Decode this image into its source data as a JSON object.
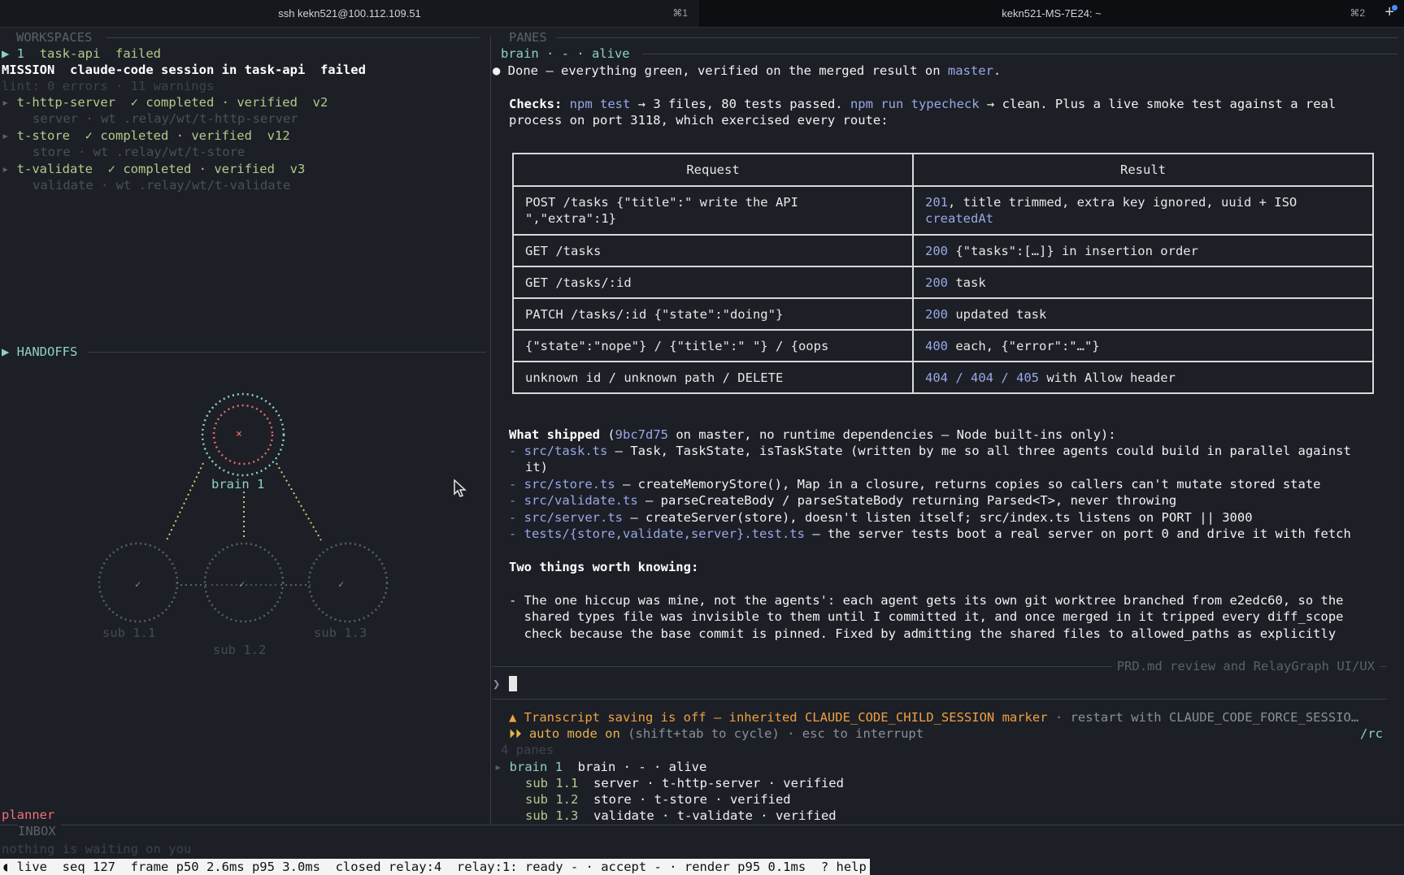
{
  "tabs": [
    {
      "title": "ssh kekn521@100.112.109.51",
      "shortcut": "⌘1"
    },
    {
      "title": "kekn521-MS-7E24: ~",
      "shortcut": "⌘2"
    }
  ],
  "new_tab_label": "+",
  "left": {
    "workspaces_header": "WORKSPACES",
    "workspace": {
      "index": "1",
      "name": "task-api",
      "status": "failed"
    },
    "mission": {
      "label": "MISSION",
      "text": "claude-code session in task-api",
      "status": "failed"
    },
    "lint": "lint: 0 errors · 11 warnings",
    "tasks": [
      {
        "name": "t-http-server",
        "status": "✓ completed · verified",
        "version": "v2",
        "detail": "server · wt .relay/wt/t-http-server"
      },
      {
        "name": "t-store",
        "status": "✓ completed · verified",
        "version": "v12",
        "detail": "store · wt .relay/wt/t-store"
      },
      {
        "name": "t-validate",
        "status": "✓ completed · verified",
        "version": "v3",
        "detail": "validate · wt .relay/wt/t-validate"
      }
    ],
    "handoffs_header": "HANDOFFS",
    "graph": {
      "brain_label": "brain 1",
      "brain_mark": "×",
      "subs": [
        {
          "label": "sub 1.1",
          "mark": "✓"
        },
        {
          "label": "sub 1.2",
          "mark": "✓"
        },
        {
          "label": "sub 1.3",
          "mark": "✓"
        }
      ]
    },
    "planner": "planner",
    "inbox_header": "INBOX",
    "inbox_text": "nothing is waiting on you"
  },
  "right": {
    "panes_header": "PANES",
    "pane_title": "brain · - · alive",
    "done_line": {
      "text": "Done — everything green, verified on the merged result on ",
      "branch": "master",
      "end": "."
    },
    "checks": {
      "label": "Checks:",
      "cmd1": "npm test",
      "res1": " → 3 files, 80 tests passed. ",
      "cmd2": "npm run typecheck",
      "res2": " → clean. Plus a live smoke test against a real",
      "line2": "process on port 3118, which exercised every route:"
    },
    "table": {
      "headers": [
        "Request",
        "Result"
      ],
      "rows": [
        {
          "req": [
            "POST /tasks {\"title\":\"  write the API",
            "\",\"extra\":1}"
          ],
          "res_num": "201",
          "res": [
            ", title trimmed, extra key ignored, uuid + ISO",
            "createdAt"
          ]
        },
        {
          "req": [
            "GET /tasks"
          ],
          "res_num": "200",
          "res": [
            " {\"tasks\":[…]} in insertion order"
          ]
        },
        {
          "req": [
            "GET /tasks/:id"
          ],
          "res_num": "200",
          "res": [
            " task"
          ]
        },
        {
          "req": [
            "PATCH /tasks/:id {\"state\":\"doing\"}"
          ],
          "res_num": "200",
          "res": [
            " updated task"
          ]
        },
        {
          "req": [
            "{\"state\":\"nope\"} / {\"title\":\"   \"} / {oops"
          ],
          "res_num": "400",
          "res": [
            " each, {\"error\":\"…\"}"
          ]
        },
        {
          "req": [
            "unknown id / unknown path / DELETE"
          ],
          "res_num": "404 / 404 / 405",
          "res": [
            " with Allow header"
          ]
        }
      ]
    },
    "shipped": {
      "label": "What shipped",
      "hash": "9bc7d75",
      "rest": " on master, no runtime dependencies — Node built-ins only):",
      "items": [
        {
          "file": "src/task.ts",
          "text": " — Task, TaskState, isTaskState (written by me so all three agents could build in parallel against",
          "cont": "it)"
        },
        {
          "file": "src/store.ts",
          "text": " — createMemoryStore(), Map in a closure, returns copies so callers can't mutate stored state"
        },
        {
          "file": "src/validate.ts",
          "text": " — parseCreateBody / parseStateBody returning Parsed<T>, never throwing"
        },
        {
          "file": "src/server.ts",
          "text": " — createServer(store), doesn't listen itself; src/index.ts listens on PORT || 3000"
        },
        {
          "file": "tests/{store,validate,server}.test.ts",
          "text": " — the server tests boot a real server on port 0 and drive it with fetch"
        }
      ]
    },
    "two_things": "Two things worth knowing:",
    "hiccup": [
      "- The one hiccup was mine, not the agents': each agent gets its own git worktree branched from e2edc60, so the",
      "  shared types file was invisible to them until I committed it, and once merged in it tripped every diff_scope",
      "  check because the base commit is pinned. Fixed by admitting the shared files to allowed_paths as explicitly"
    ],
    "session_title": "PRD.md review and RelayGraph UI/UX",
    "prompt_symbol": "❯",
    "warning": "▲ Transcript saving is off — inherited CLAUDE_CODE_CHILD_SESSION marker",
    "warning_tail": " · restart with CLAUDE_CODE_FORCE_SESSIO…",
    "auto_mode": {
      "prefix": "⏵⏵ auto mode on",
      "rest": " (shift+tab to cycle) · esc to interrupt",
      "right": "/rc"
    },
    "panes_count": "4 panes",
    "pane_list": [
      {
        "id": "brain 1",
        "text": "brain · - · alive"
      },
      {
        "id": "sub 1.1",
        "text": "server · t-http-server · verified"
      },
      {
        "id": "sub 1.2",
        "text": "store · t-store · verified"
      },
      {
        "id": "sub 1.3",
        "text": "validate · t-validate · verified"
      }
    ]
  },
  "statusbar": "◖ live  seq 127  frame p50 2.6ms p95 3.0ms  closed relay:4  relay:1: ready - · accept - · render p95 0.1ms  ? help"
}
